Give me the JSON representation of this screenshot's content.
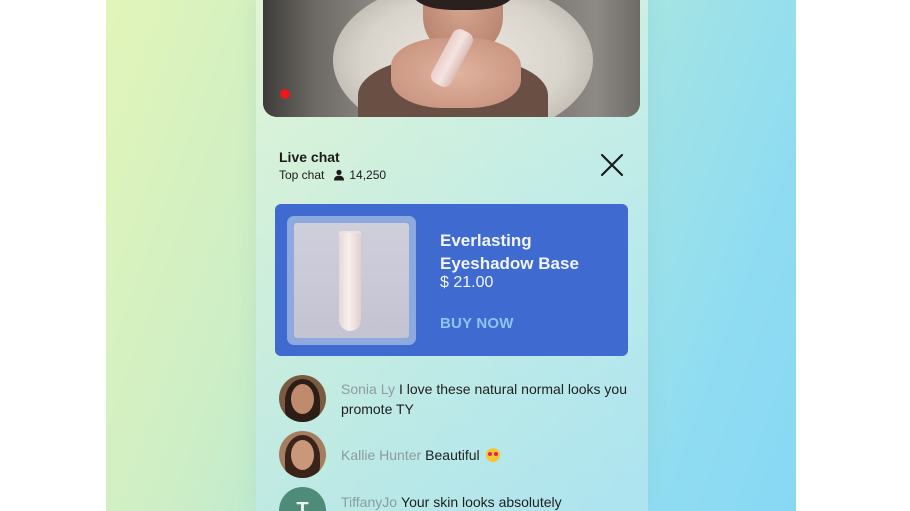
{
  "chat": {
    "title": "Live chat",
    "filter_label": "Top chat",
    "viewer_count": "14,250",
    "viewer_icon": "person-icon",
    "close_icon": "close-icon"
  },
  "product": {
    "name": "Everlasting Eyeshadow Base",
    "price": "$ 21.00",
    "cta": "BUY NOW"
  },
  "messages": [
    {
      "user": "Sonia Ly",
      "text": "I love these natural normal looks you promote TY",
      "emoji": ""
    },
    {
      "user": "Kallie Hunter",
      "text": "Beautiful",
      "emoji": "heart-eyes-emoji"
    },
    {
      "user": "TiffanyJo",
      "text": "Your skin looks absolutely",
      "emoji": "",
      "avatar_initial": "T"
    }
  ],
  "colors": {
    "card_blue": "#3f6ad0",
    "cta_light_blue": "#8fc4f6",
    "recording_red": "#e81a1a",
    "username_gray": "#8d9c9c",
    "avatar_teal": "#4e8c79"
  }
}
